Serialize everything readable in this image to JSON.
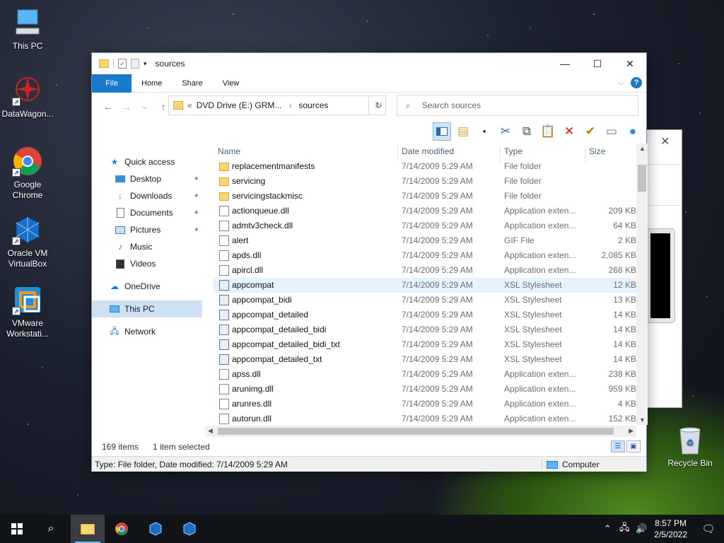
{
  "desktop": {
    "icons": [
      {
        "label": "This PC",
        "icon": "this-pc-icon"
      },
      {
        "label": "DataWagon...",
        "icon": "datawagon-icon"
      },
      {
        "label": "Google Chrome",
        "icon": "chrome-icon"
      },
      {
        "label": "Oracle VM VirtualBox",
        "icon": "virtualbox-icon"
      },
      {
        "label": "VMware Workstati...",
        "icon": "vmware-icon"
      }
    ],
    "recycle_bin": "Recycle Bin"
  },
  "window": {
    "title": "sources",
    "ribbon_tabs": [
      "File",
      "Home",
      "Share",
      "View"
    ],
    "help_glyph": "?",
    "address": {
      "prefix": "«",
      "crumbs": [
        "DVD Drive (E:) GRM...",
        "sources"
      ],
      "separator": "›"
    },
    "search_placeholder": "Search sources",
    "nav": {
      "quick_access": "Quick access",
      "pinned": [
        {
          "label": "Desktop",
          "pinned": true
        },
        {
          "label": "Downloads",
          "pinned": true
        },
        {
          "label": "Documents",
          "pinned": true
        },
        {
          "label": "Pictures",
          "pinned": true
        },
        {
          "label": "Music",
          "pinned": false
        },
        {
          "label": "Videos",
          "pinned": false
        }
      ],
      "onedrive": "OneDrive",
      "this_pc": "This PC",
      "network": "Network"
    },
    "columns": {
      "name": "Name",
      "date": "Date modified",
      "type": "Type",
      "size": "Size"
    },
    "files": [
      {
        "name": "replacementmanifests",
        "date": "7/14/2009 5:29 AM",
        "type": "File folder",
        "size": "",
        "kind": "folder"
      },
      {
        "name": "servicing",
        "date": "7/14/2009 5:29 AM",
        "type": "File folder",
        "size": "",
        "kind": "folder"
      },
      {
        "name": "servicingstackmisc",
        "date": "7/14/2009 5:29 AM",
        "type": "File folder",
        "size": "",
        "kind": "folder"
      },
      {
        "name": "actionqueue.dll",
        "date": "7/14/2009 5:29 AM",
        "type": "Application exten...",
        "size": "209 KB",
        "kind": "dll"
      },
      {
        "name": "admtv3check.dll",
        "date": "7/14/2009 5:29 AM",
        "type": "Application exten...",
        "size": "64 KB",
        "kind": "dll"
      },
      {
        "name": "alert",
        "date": "7/14/2009 5:29 AM",
        "type": "GIF File",
        "size": "2 KB",
        "kind": "gif"
      },
      {
        "name": "apds.dll",
        "date": "7/14/2009 5:29 AM",
        "type": "Application exten...",
        "size": "2,085 KB",
        "kind": "dll"
      },
      {
        "name": "apircl.dll",
        "date": "7/14/2009 5:29 AM",
        "type": "Application exten...",
        "size": "268 KB",
        "kind": "dll"
      },
      {
        "name": "appcompat",
        "date": "7/14/2009 5:29 AM",
        "type": "XSL Stylesheet",
        "size": "12 KB",
        "kind": "xsl"
      },
      {
        "name": "appcompat_bidi",
        "date": "7/14/2009 5:29 AM",
        "type": "XSL Stylesheet",
        "size": "13 KB",
        "kind": "xsl"
      },
      {
        "name": "appcompat_detailed",
        "date": "7/14/2009 5:29 AM",
        "type": "XSL Stylesheet",
        "size": "14 KB",
        "kind": "xsl"
      },
      {
        "name": "appcompat_detailed_bidi",
        "date": "7/14/2009 5:29 AM",
        "type": "XSL Stylesheet",
        "size": "14 KB",
        "kind": "xsl"
      },
      {
        "name": "appcompat_detailed_bidi_txt",
        "date": "7/14/2009 5:29 AM",
        "type": "XSL Stylesheet",
        "size": "14 KB",
        "kind": "xsl"
      },
      {
        "name": "appcompat_detailed_txt",
        "date": "7/14/2009 5:29 AM",
        "type": "XSL Stylesheet",
        "size": "14 KB",
        "kind": "xsl"
      },
      {
        "name": "apss.dll",
        "date": "7/14/2009 5:29 AM",
        "type": "Application exten...",
        "size": "238 KB",
        "kind": "dll"
      },
      {
        "name": "arunimg.dll",
        "date": "7/14/2009 5:29 AM",
        "type": "Application exten...",
        "size": "959 KB",
        "kind": "dll"
      },
      {
        "name": "arunres.dll",
        "date": "7/14/2009 5:29 AM",
        "type": "Application exten...",
        "size": "4 KB",
        "kind": "dll"
      },
      {
        "name": "autorun.dll",
        "date": "7/14/2009 5:29 AM",
        "type": "Application exten...",
        "size": "152 KB",
        "kind": "dll"
      }
    ],
    "selected_row": "appcompat",
    "status": {
      "count": "169 items",
      "selection": "1 item selected"
    },
    "details_bar": {
      "info": "Type: File folder, Date modified: 7/14/2009 5:29 AM",
      "location": "Computer"
    }
  },
  "taskbar": {
    "time": "8:57 PM",
    "date": "2/5/2022",
    "apps": [
      "file-explorer-icon",
      "chrome-icon",
      "virtualbox-icon",
      "virtualbox-icon"
    ]
  },
  "colors": {
    "accent": "#1979ca",
    "selection": "#cde1f3",
    "hover_row": "#e5f3ff"
  }
}
